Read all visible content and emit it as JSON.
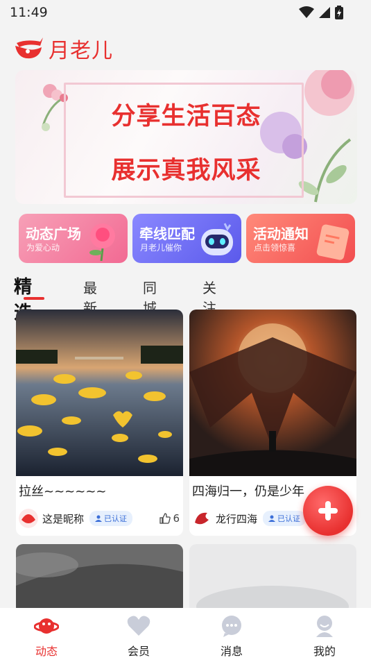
{
  "status_bar": {
    "time": "11:49"
  },
  "app": {
    "name": "月老儿",
    "brand_color": "#e8302f"
  },
  "banner": {
    "line1": "分享生活百态",
    "line2": "展示真我风采"
  },
  "features": [
    {
      "title": "动态广场",
      "subtitle": "为爱心动",
      "color": "#f26a93"
    },
    {
      "title": "牵线匹配",
      "subtitle": "月老儿催你",
      "color": "#6f6ef3"
    },
    {
      "title": "活动通知",
      "subtitle": "点击领惊喜",
      "color": "#f35f5f"
    }
  ],
  "tabs": [
    {
      "label": "精选",
      "active": true
    },
    {
      "label": "最新"
    },
    {
      "label": "同城"
    },
    {
      "label": "关注"
    }
  ],
  "posts": [
    {
      "title": "拉丝~~~~~~",
      "author": "这是昵称",
      "badge": "已认证",
      "likes": "6"
    },
    {
      "title": "四海归一，仍是少年",
      "author": "龙行四海",
      "badge": "已认证"
    }
  ],
  "bottom_nav": [
    {
      "label": "动态",
      "icon": "planet-icon",
      "active": true
    },
    {
      "label": "会员",
      "icon": "heart-icon"
    },
    {
      "label": "消息",
      "icon": "chat-bubble-icon"
    },
    {
      "label": "我的",
      "icon": "person-icon"
    }
  ]
}
